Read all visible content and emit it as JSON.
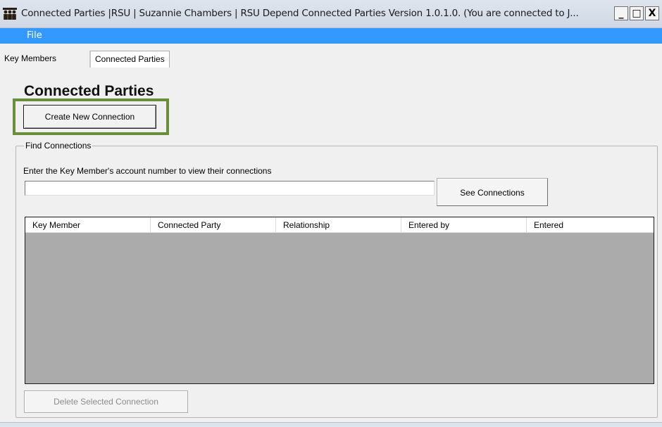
{
  "window": {
    "title": "Connected Parties |RSU | Suzannie Chambers | RSU Depend Connected Parties Version 1.0.1.0. (You are connected to J...",
    "minimize_label": "_",
    "maximize_label": "□",
    "close_label": "X"
  },
  "menu": {
    "file_label": "File"
  },
  "tabs": [
    {
      "label": "Key Members",
      "selected": false
    },
    {
      "label": "Connected Parties",
      "selected": true
    }
  ],
  "page": {
    "title": "Connected Parties",
    "create_button_label": "Create New Connection"
  },
  "find_group": {
    "legend": "Find Connections",
    "prompt": "Enter the Key Member's account number to view their connections",
    "account_value": "",
    "account_placeholder": "",
    "see_button_label": "See Connections"
  },
  "grid": {
    "columns": [
      "Key Member",
      "Connected Party",
      "Relationship",
      "Entered by",
      "Entered"
    ],
    "rows": []
  },
  "delete_button_label": "Delete Selected Connection",
  "colors": {
    "menubar": "#3399ff",
    "highlight": "#6b8e3a",
    "grid_background": "#ababab"
  },
  "icons": {
    "app": "people-group-icon"
  }
}
